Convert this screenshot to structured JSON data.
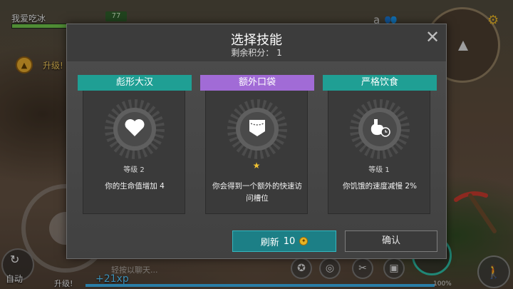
{
  "hud": {
    "player_name": "我爱吃冰",
    "hp_value": "77",
    "hp_fraction": 0.77,
    "levelup_text": "升级!",
    "auto_label": "自动",
    "xp_gain": "+21xp",
    "levelup_bottom": "升级!",
    "xp_percent": "100%",
    "xp_fraction": 1.0,
    "chat_hint": "轻按以聊天..."
  },
  "dialog": {
    "title": "选择技能",
    "points_label": "剩余积分：",
    "points_value": "1",
    "close_label": "✕"
  },
  "cards": [
    {
      "name": "彪形大汉",
      "ribbon_color": "#1f9f94",
      "level": "等级 2",
      "description": "你的生命值增加 4",
      "icon": "heart-icon"
    },
    {
      "name": "额外口袋",
      "ribbon_color": "#a16bd6",
      "star": "★",
      "description": "你会得到一个额外的快速访问槽位",
      "icon": "pocket-icon"
    },
    {
      "name": "严格饮食",
      "ribbon_color": "#1f9f94",
      "level": "等级 1",
      "description": "你饥饿的速度减慢 2%",
      "icon": "stomach-clock-icon"
    }
  ],
  "actions": {
    "refresh_label": "刷新",
    "refresh_cost": "10",
    "confirm_label": "确认"
  },
  "colors": {
    "accent_teal": "#1f9f94",
    "accent_purple": "#a16bd6",
    "coin_gold": "#e7b423"
  }
}
